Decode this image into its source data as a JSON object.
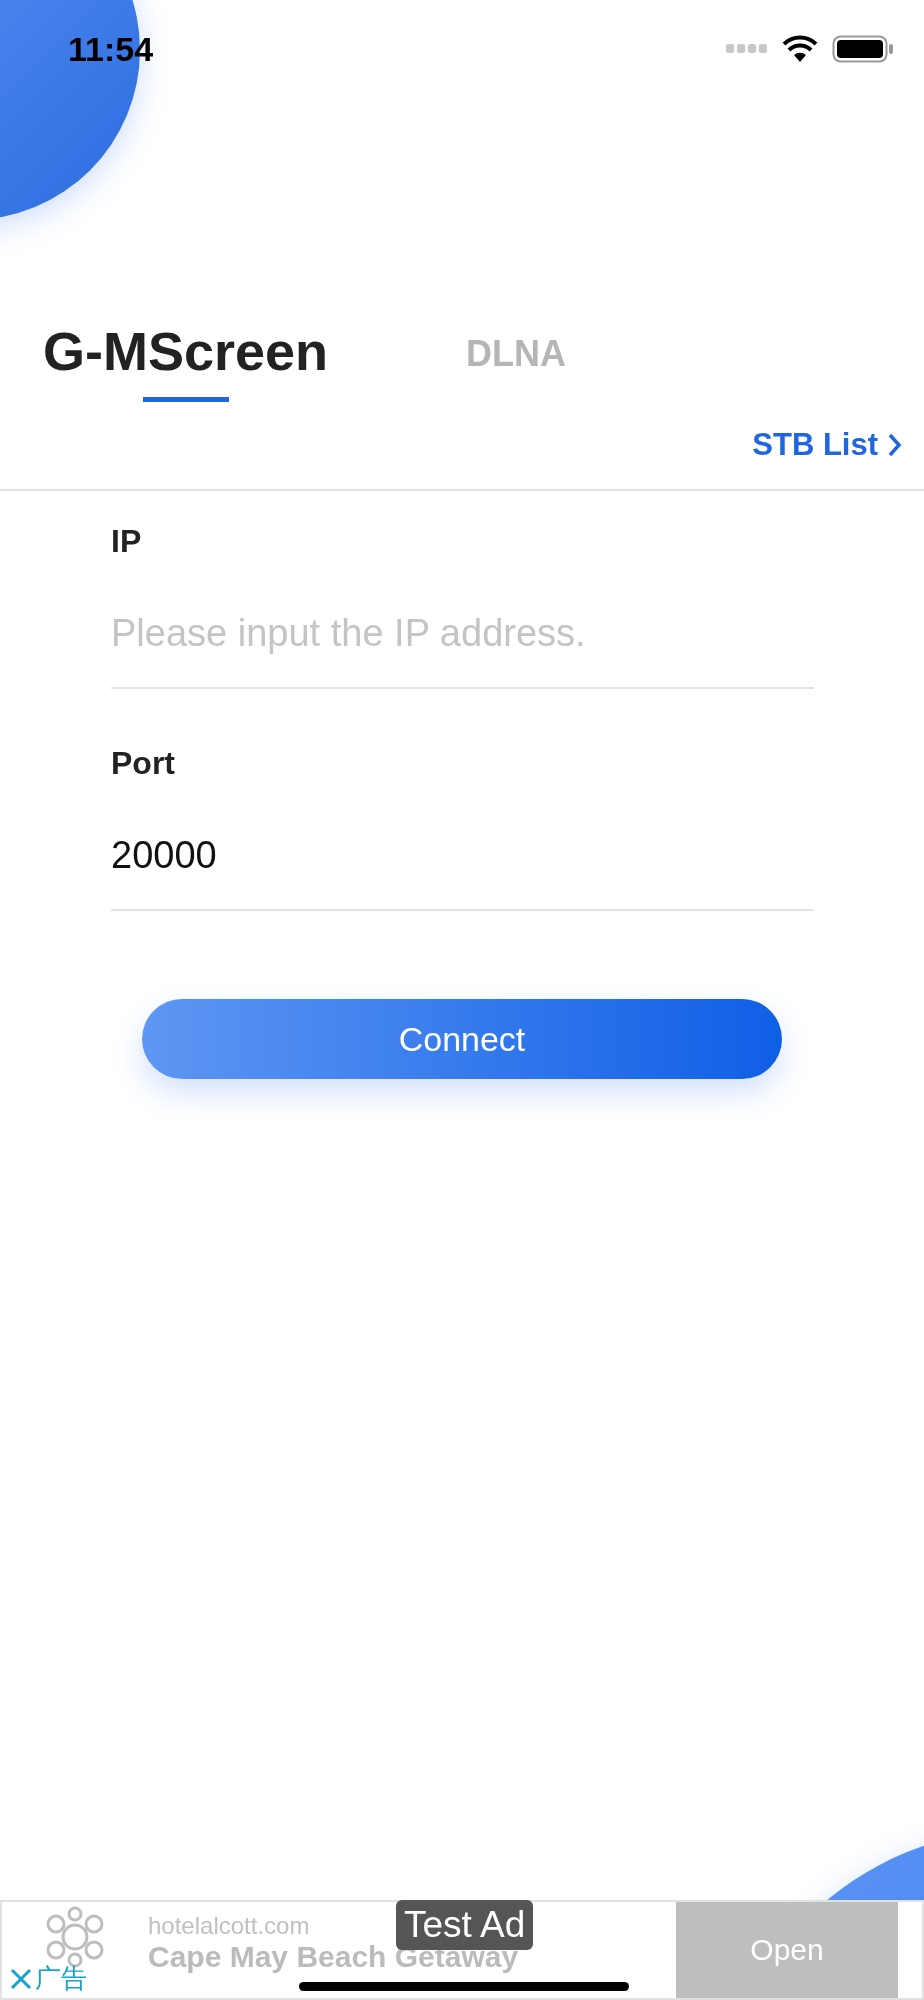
{
  "status_bar": {
    "time": "11:54"
  },
  "tabs": [
    {
      "label": "G-MScreen",
      "selected": true
    },
    {
      "label": "DLNA",
      "selected": false
    }
  ],
  "stb_link": {
    "label": "STB List"
  },
  "form": {
    "fields": [
      {
        "label": "IP",
        "placeholder": "Please input the IP address."
      },
      {
        "label": "Port",
        "value": "20000"
      }
    ]
  },
  "connect_button": {
    "label": "Connect"
  },
  "ad": {
    "domain": "hotelalcott.com",
    "headline": "Cape May Beach Getaway",
    "badge": "Test Ad",
    "button": "Open",
    "close_label": "广告"
  }
}
